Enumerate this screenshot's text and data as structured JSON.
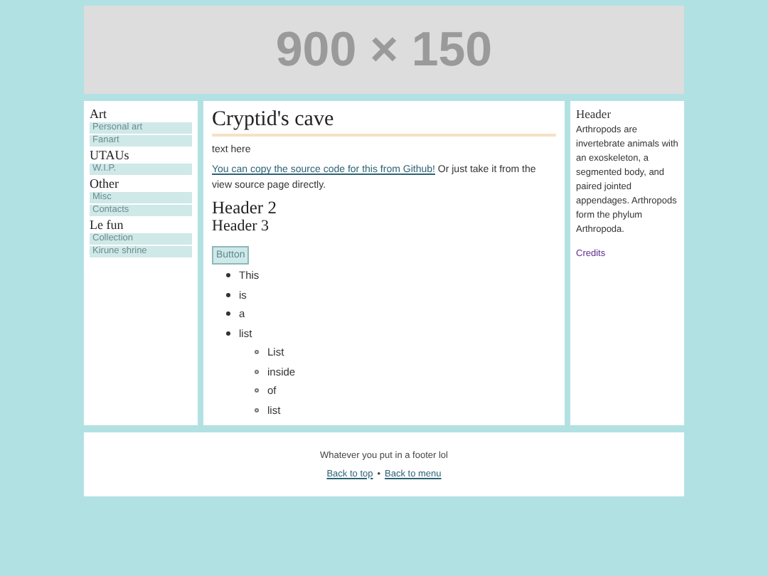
{
  "banner": {
    "text": "900 × 150"
  },
  "sidebar": {
    "groups": [
      {
        "heading": "Art",
        "items": [
          "Personal art",
          "Fanart"
        ]
      },
      {
        "heading": "UTAUs",
        "items": [
          "W.I.P."
        ]
      },
      {
        "heading": "Other",
        "items": [
          "Misc",
          "Contacts"
        ]
      },
      {
        "heading": "Le fun",
        "items": [
          "Collection",
          "Kirune shrine"
        ]
      }
    ]
  },
  "main": {
    "title": "Cryptid's cave",
    "intro": "text here",
    "link": "You can copy the source code for this from Github!",
    "after_link": " Or just take it from the view source page directly.",
    "header_2": "Header 2",
    "header_3": "Header 3",
    "button": "Button",
    "list": [
      {
        "text": "This"
      },
      {
        "text": "is"
      },
      {
        "text": "a"
      },
      {
        "text": "list",
        "children": [
          {
            "text": "List"
          },
          {
            "text": "inside"
          },
          {
            "text": "of"
          },
          {
            "text": "list"
          }
        ]
      }
    ]
  },
  "aside": {
    "heading": "Header",
    "text": "Arthropods are invertebrate animals with an exoskeleton, a segmented body, and paired jointed appendages. Arthropods form the phylum Arthropoda.",
    "link": "Credits"
  },
  "footer": {
    "text": "Whatever you put in a footer lol",
    "links": [
      "Back to top",
      "Back to menu"
    ],
    "separator": "•"
  }
}
